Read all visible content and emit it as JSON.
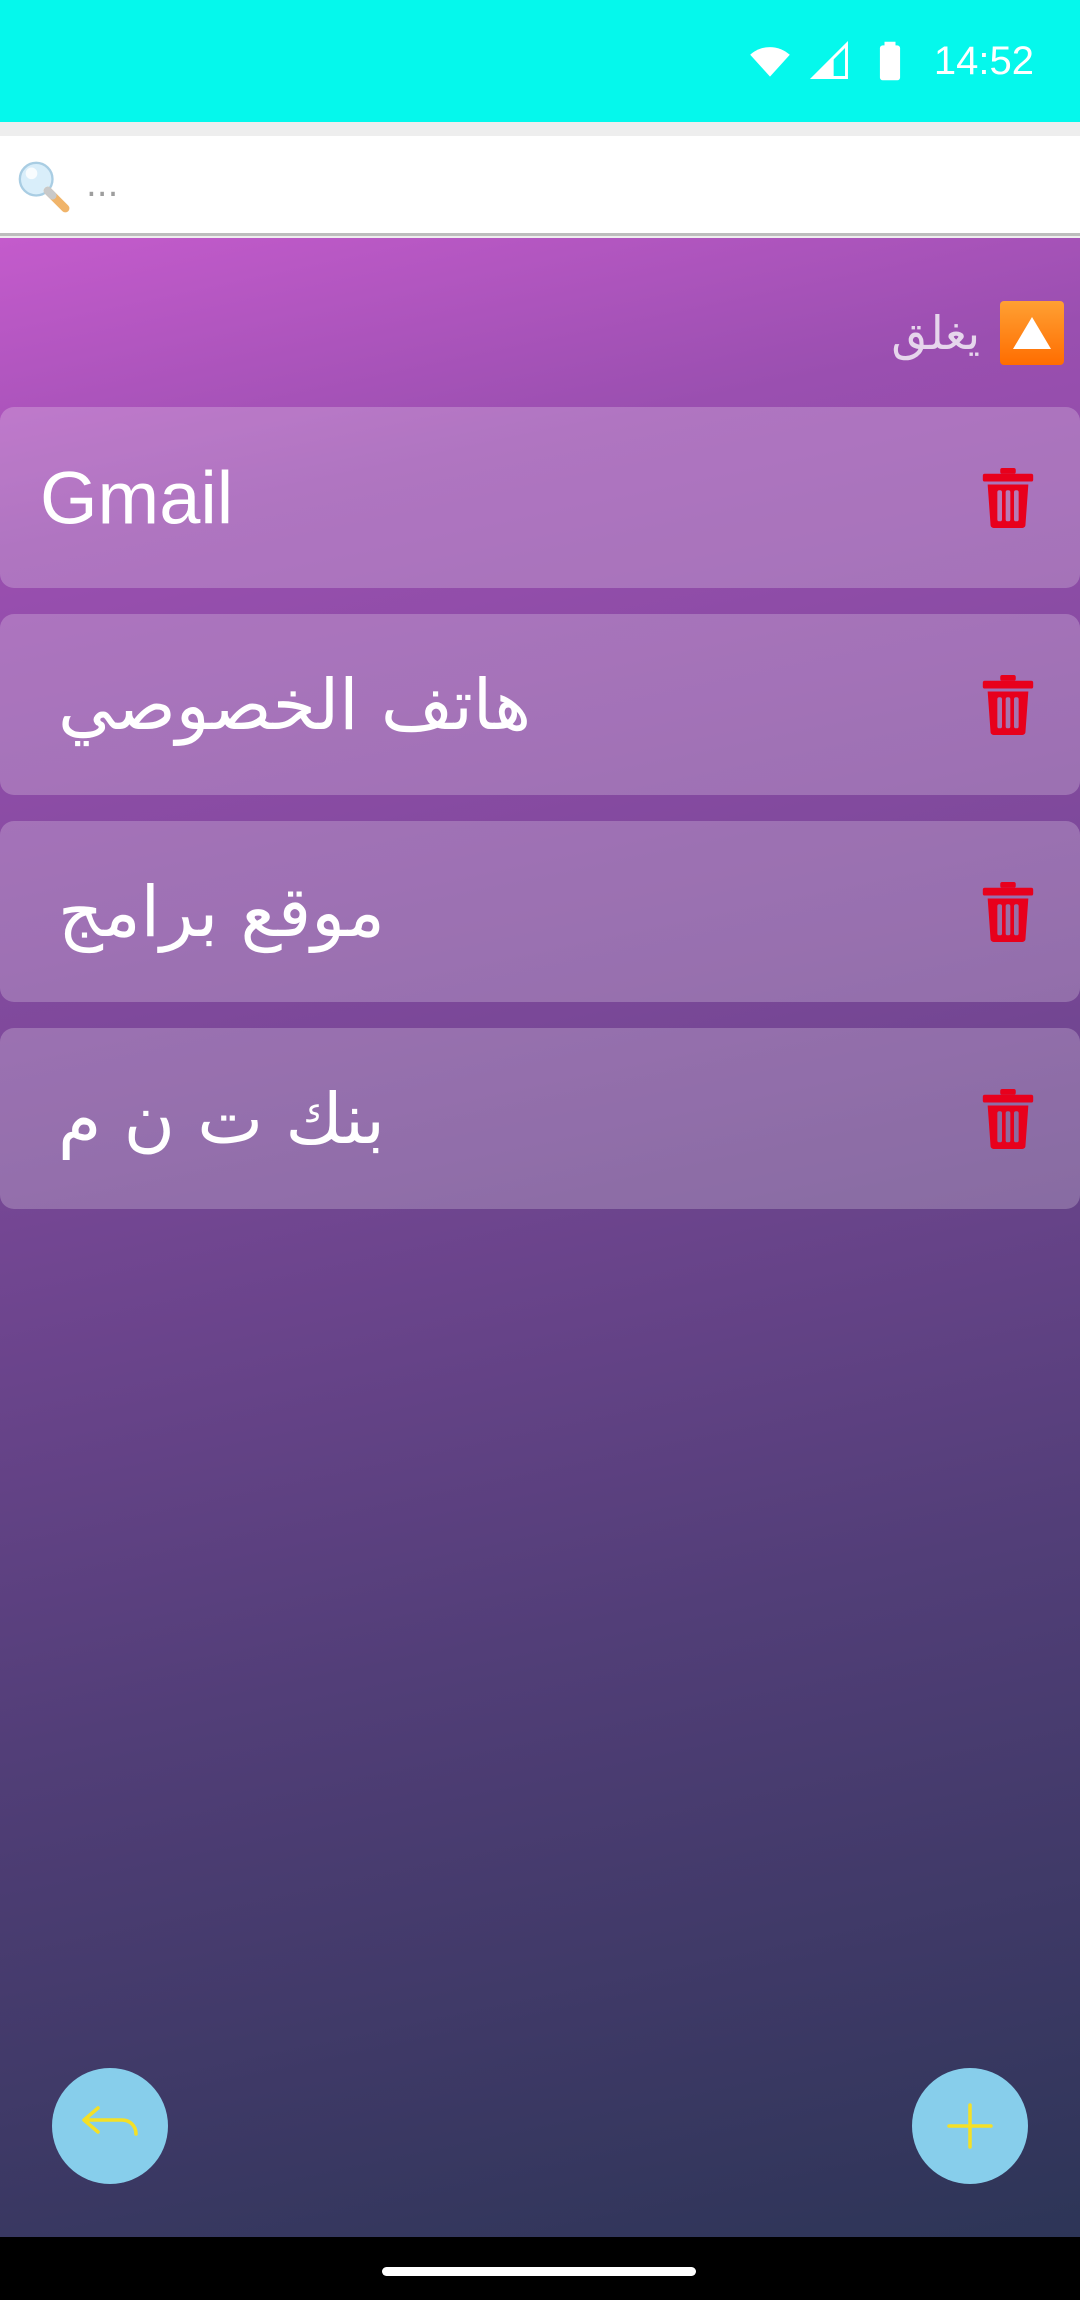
{
  "status_bar": {
    "time": "14:52",
    "background": "#05F8EC",
    "icons": [
      "wifi-icon",
      "cell-signal-icon",
      "battery-icon"
    ]
  },
  "search": {
    "placeholder": "...",
    "value": "",
    "icon": "magnifier-icon"
  },
  "toolbar": {
    "toggle_label": "يغلق",
    "toggle_icon": "collapse-arrow-up-icon",
    "toggle_icon_color": "#FF7A00"
  },
  "entries": [
    {
      "name": "Gmail",
      "delete_icon": "trash-icon"
    },
    {
      "name": "هاتف الخصوصي",
      "delete_icon": "trash-icon"
    },
    {
      "name": "موقع برامج",
      "delete_icon": "trash-icon"
    },
    {
      "name": "بنك ت ن م",
      "delete_icon": "trash-icon"
    }
  ],
  "buttons": {
    "back_icon": "return-arrow-icon",
    "add_icon": "plus-icon",
    "fab_color": "#87CEEB",
    "fab_icon_color": "#F5E026"
  },
  "colors": {
    "delete": "#E8001C",
    "gradient_top": "#C45BCC",
    "gradient_bottom": "#2D3557"
  }
}
